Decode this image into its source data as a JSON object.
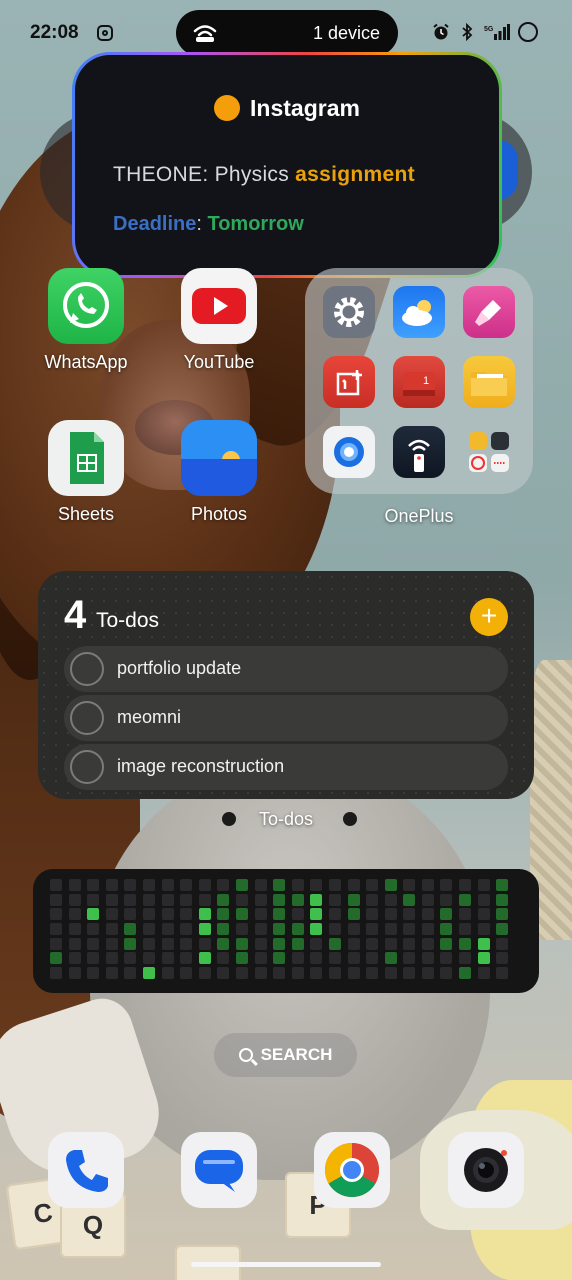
{
  "status_bar": {
    "time": "22:08",
    "island_text": "1 device"
  },
  "notification": {
    "app_name": "Instagram",
    "sender": "THEONE",
    "message_plain": ": Physics ",
    "message_highlight": "assignment",
    "deadline_label": "Deadline",
    "deadline_sep": ": ",
    "deadline_value": "Tomorrow",
    "colors": {
      "highlight": "#e9a20d",
      "deadline_label": "#3b6fc4",
      "deadline_value": "#2ea85a"
    }
  },
  "apps": [
    {
      "label": "WhatsApp",
      "icon": "whatsapp-icon"
    },
    {
      "label": "YouTube",
      "icon": "youtube-icon"
    },
    {
      "label": "Sheets",
      "icon": "sheets-icon"
    },
    {
      "label": "Photos",
      "icon": "photos-icon"
    }
  ],
  "folder": {
    "label": "OnePlus",
    "icons": [
      "settings-icon",
      "weather-icon",
      "theme-store-icon",
      "oneplus-community-icon",
      "calendar-icon",
      "files-icon",
      "clone-phone-icon",
      "remote-icon",
      "tools-icon"
    ],
    "calendar_badge": "1"
  },
  "todo_widget": {
    "count": "4",
    "title": "To-dos",
    "add_label": "+",
    "items": [
      "portfolio update",
      "meomni",
      "image reconstruction"
    ],
    "caption": "To-dos"
  },
  "search": {
    "label": "SEARCH"
  },
  "dock": [
    "phone-icon",
    "messages-icon",
    "chrome-icon",
    "camera-icon"
  ]
}
